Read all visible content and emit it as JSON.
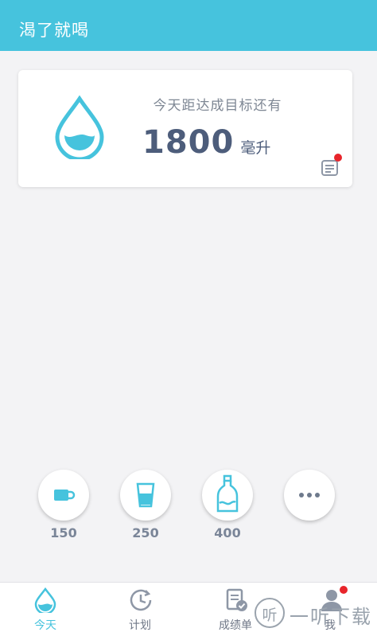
{
  "app_bar": {
    "title": "渴了就喝"
  },
  "goal_card": {
    "label": "今天距达成目标还有",
    "remaining_value": "1800",
    "unit": "毫升",
    "note_has_badge": true
  },
  "quick_add": [
    {
      "icon": "coffee-cup-icon",
      "label": "150"
    },
    {
      "icon": "glass-icon",
      "label": "250"
    },
    {
      "icon": "bottle-icon",
      "label": "400"
    },
    {
      "icon": "more-icon",
      "label": ""
    }
  ],
  "tabbar": {
    "tabs": [
      {
        "icon": "water-drop-icon",
        "label": "今天",
        "active": true
      },
      {
        "icon": "clock-icon",
        "label": "计划",
        "active": false
      },
      {
        "icon": "report-icon",
        "label": "成绩单",
        "active": false
      },
      {
        "icon": "user-icon",
        "label": "我",
        "active": false,
        "badge": true
      }
    ]
  },
  "watermark": {
    "glyph": "听",
    "text": "一听下载"
  },
  "colors": {
    "primary": "#46c3dd",
    "value_text": "#4d5d7b",
    "muted_text": "#7a8598",
    "badge": "#e8252b",
    "background": "#f3f3f5"
  }
}
